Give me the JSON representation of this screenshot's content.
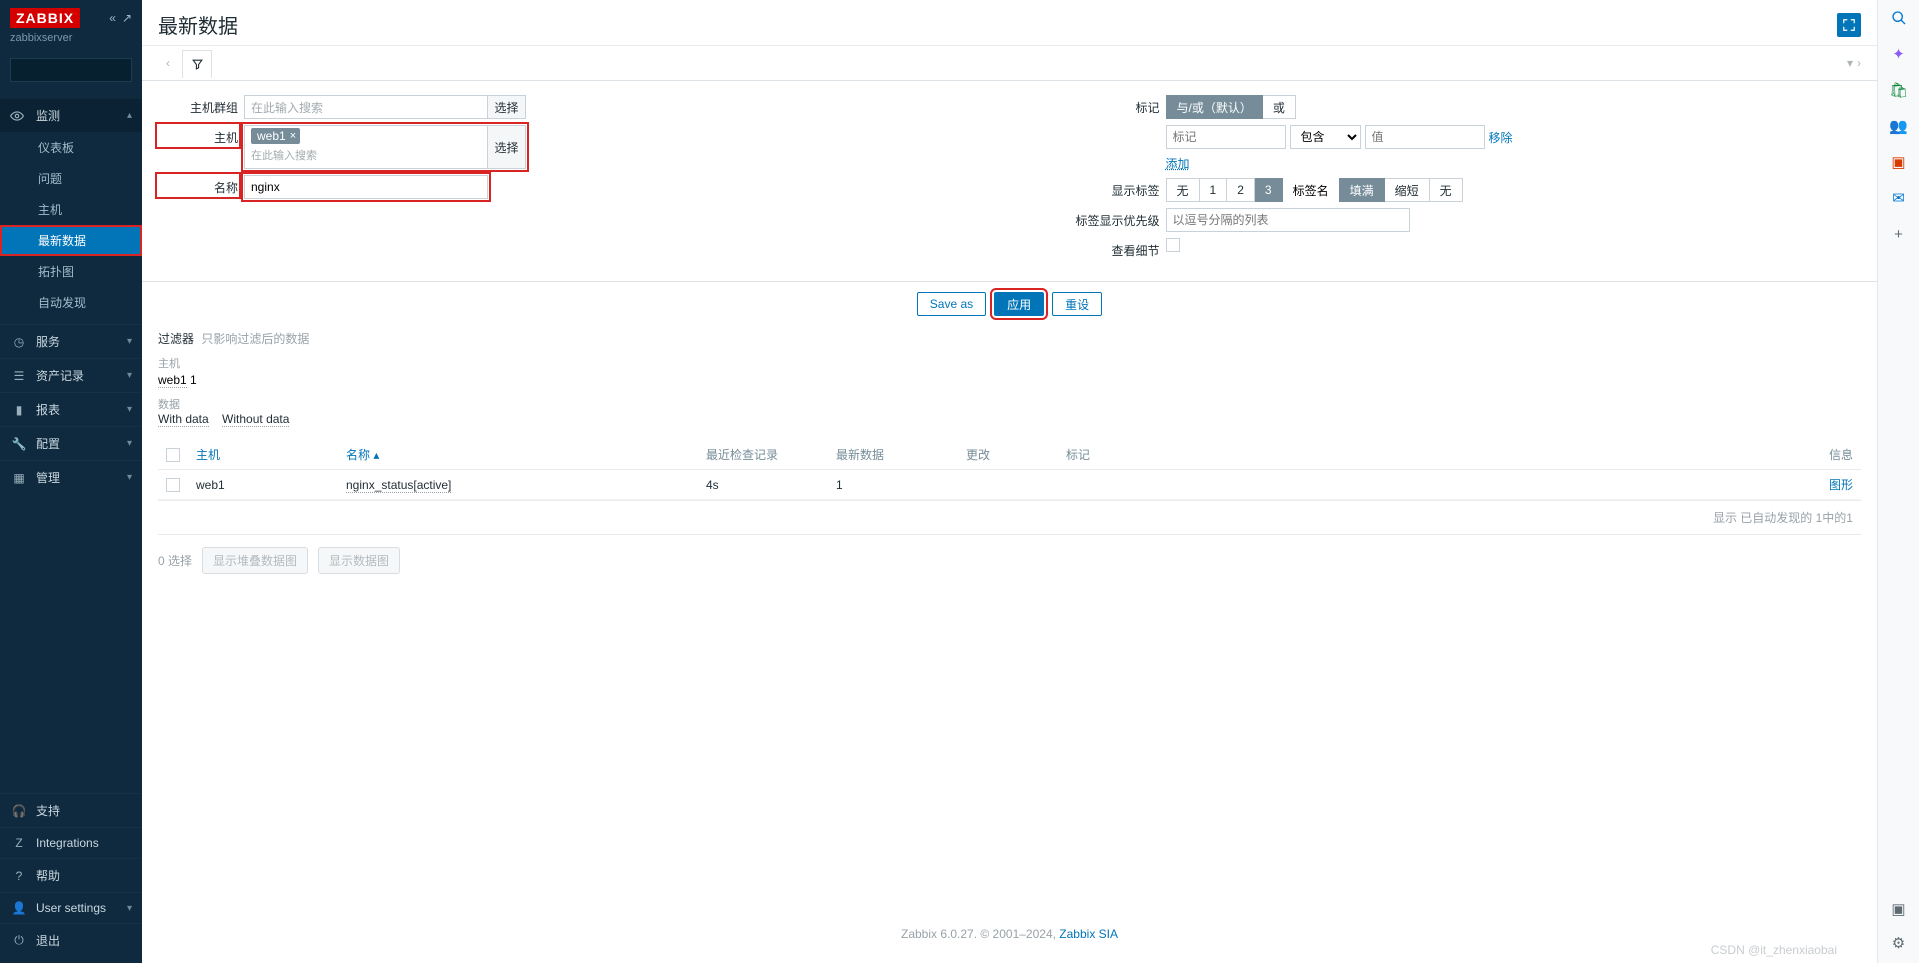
{
  "brand": {
    "logo": "ZABBIX",
    "server": "zabbixserver"
  },
  "sidebar": {
    "search_placeholder": "",
    "monitoring": {
      "label": "监测",
      "items": [
        "仪表板",
        "问题",
        "主机",
        "最新数据",
        "拓扑图",
        "自动发现"
      ],
      "active": 3
    },
    "sections": [
      {
        "icon": "clock",
        "label": "服务"
      },
      {
        "icon": "list",
        "label": "资产记录"
      },
      {
        "icon": "chart",
        "label": "报表"
      },
      {
        "icon": "wrench",
        "label": "配置"
      },
      {
        "icon": "grid",
        "label": "管理"
      }
    ],
    "bottom": [
      {
        "icon": "headset",
        "label": "支持"
      },
      {
        "icon": "z",
        "label": "Integrations"
      },
      {
        "icon": "help",
        "label": "帮助"
      },
      {
        "icon": "user",
        "label": "User settings",
        "chev": true
      },
      {
        "icon": "power",
        "label": "退出"
      }
    ]
  },
  "page": {
    "title": "最新数据"
  },
  "filter": {
    "hostgroup": {
      "label": "主机群组",
      "placeholder": "在此输入搜索",
      "select": "选择"
    },
    "host": {
      "label": "主机",
      "token": "web1",
      "placeholder": "在此输入搜索",
      "select": "选择"
    },
    "name": {
      "label": "名称",
      "value": "nginx"
    },
    "tags": {
      "label": "标记",
      "andor": "与/或（默认）",
      "or": "或",
      "tag_ph": "标记",
      "op": "包含",
      "val_ph": "值",
      "remove": "移除",
      "add": "添加"
    },
    "showtags": {
      "label": "显示标签",
      "opts": [
        "无",
        "1",
        "2",
        "3"
      ],
      "selected": 3,
      "namecol": "标签名",
      "full": "填满",
      "short": "缩短",
      "none": "无"
    },
    "priority": {
      "label": "标签显示优先级",
      "placeholder": "以逗号分隔的列表"
    },
    "details": {
      "label": "查看细节"
    },
    "buttons": {
      "save": "Save as",
      "apply": "应用",
      "reset": "重设"
    }
  },
  "summary": {
    "title": "过滤器",
    "sub": "只影响过滤后的数据",
    "host": {
      "label": "主机",
      "val": "web1",
      "count": "1"
    },
    "data": {
      "label": "数据",
      "with": "With data",
      "without": "Without data"
    }
  },
  "table": {
    "headers": {
      "host": "主机",
      "name": "名称",
      "last": "最近检查记录",
      "value": "最新数据",
      "change": "更改",
      "tags": "标记",
      "info": "信息"
    },
    "row": {
      "host": "web1",
      "name": "nginx_status[active]",
      "last": "4s",
      "value": "1",
      "graph": "图形"
    },
    "footer": "显示 已自动发现的 1中的1"
  },
  "selection": {
    "count": "0 选择",
    "stacked": "显示堆叠数据图",
    "graph": "显示数据图"
  },
  "footer": {
    "text": "Zabbix 6.0.27. © 2001–2024, ",
    "link": "Zabbix SIA"
  },
  "watermark": "CSDN @it_zhenxiaobai"
}
